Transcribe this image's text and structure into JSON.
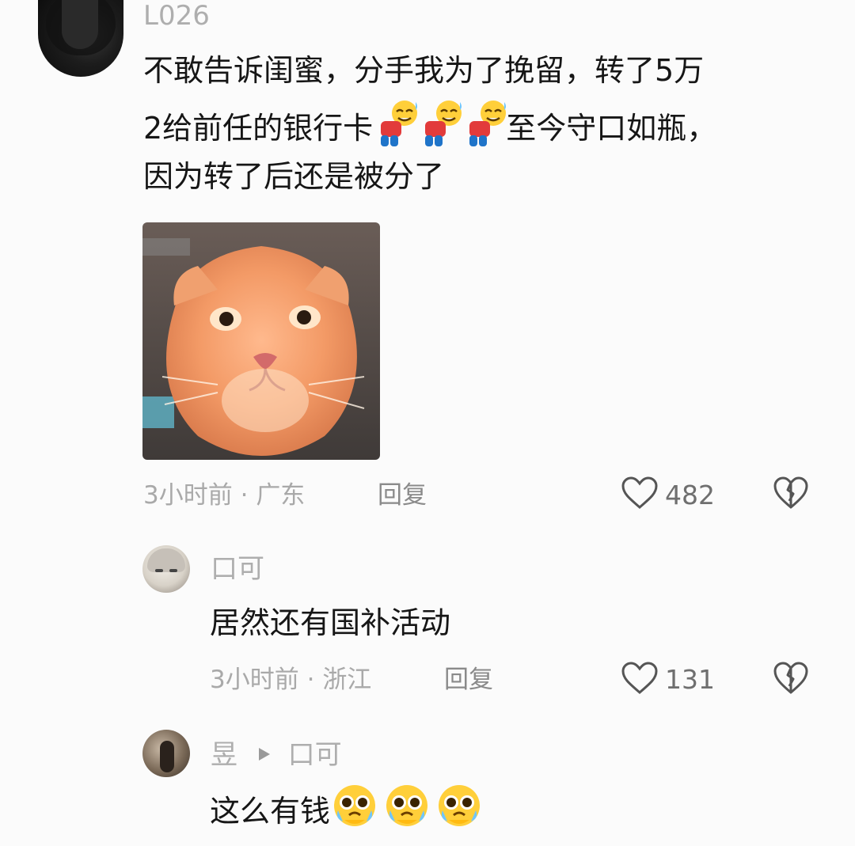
{
  "comment": {
    "username": "L026",
    "text_line1": "不敢告诉闺蜜，分手我为了挽留，转了5万",
    "text_line2a": "2给前任的银行卡",
    "text_line2b": "至今守口如瓶，",
    "text_line3": "因为转了后还是被分了",
    "emoji_names": [
      "bowing-sweat-emoji",
      "bowing-sweat-emoji",
      "bowing-sweat-emoji"
    ],
    "image": "orange-cat-photo",
    "time": "3小时前",
    "sep": "·",
    "location": "广东",
    "reply_label": "回复",
    "likes": "482"
  },
  "replies": [
    {
      "username": "口可",
      "text": "居然还有国补活动",
      "time": "3小时前",
      "sep": "·",
      "location": "浙江",
      "reply_label": "回复",
      "likes": "131"
    },
    {
      "username": "昱",
      "reply_to": "口可",
      "text": "这么有钱",
      "emoji_names": [
        "pleading-tears-emoji",
        "pleading-tears-emoji",
        "pleading-tears-emoji"
      ]
    }
  ],
  "colors": {
    "background": "#fbfbfb",
    "text": "#161616",
    "muted": "#aeaeae"
  }
}
